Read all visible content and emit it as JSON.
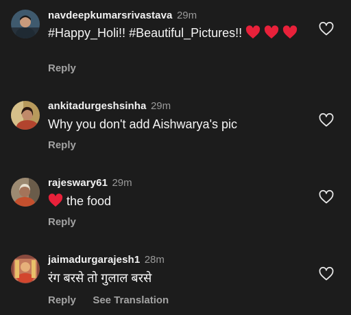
{
  "comments": [
    {
      "username": "navdeepkumarsrivastava",
      "time": "29m",
      "text": "#Happy_Holi!! #Beautiful_Pictures!!",
      "reply_label": "Reply",
      "avatar_icon": "profile-photo",
      "like_icon": "heart-outline-icon",
      "emoji": "red-heart-emoji",
      "emoji_count": 3
    },
    {
      "username": "ankitadurgeshsinha",
      "time": "29m",
      "text": "Why you don't add Aishwarya's pic",
      "reply_label": "Reply",
      "avatar_icon": "profile-photo",
      "like_icon": "heart-outline-icon"
    },
    {
      "username": "rajeswary61",
      "time": "29m",
      "text": "the food",
      "reply_label": "Reply",
      "avatar_icon": "profile-photo",
      "like_icon": "heart-outline-icon",
      "emoji": "red-heart-emoji",
      "emoji_count": 1
    },
    {
      "username": "jaimadurgarajesh1",
      "time": "28m",
      "text": "रंग बरसे तो गुलाल बरसे",
      "reply_label": "Reply",
      "translate_label": "See Translation",
      "avatar_icon": "profile-photo",
      "like_icon": "heart-outline-icon"
    }
  ],
  "colors": {
    "background": "#1c1c1c",
    "username": "#f2f2f2",
    "timestamp": "#9a9a9a",
    "action": "#a3a3a3",
    "heart_emoji": "#e8213a"
  }
}
